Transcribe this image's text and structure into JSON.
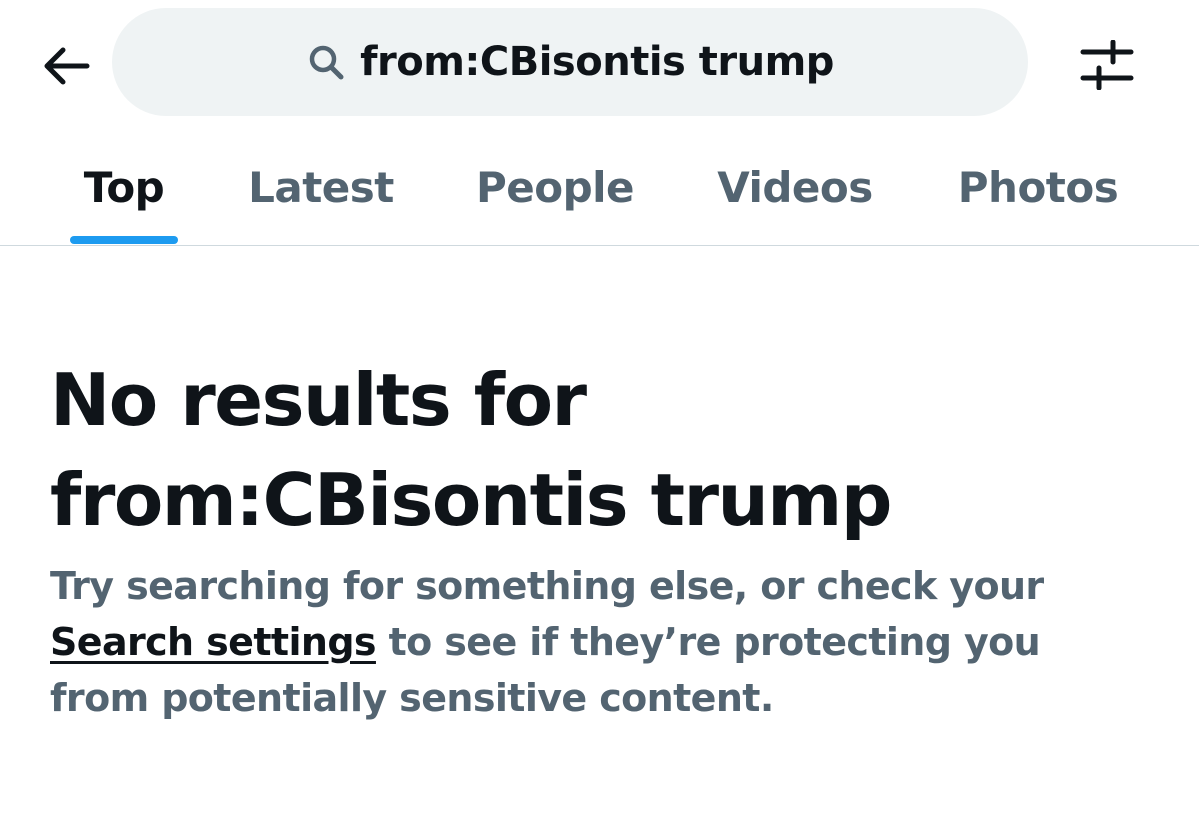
{
  "header": {
    "back_icon": "arrow-left-icon",
    "search": {
      "icon": "search-icon",
      "query": "from:CBisontis trump"
    },
    "filter_icon": "sliders-icon"
  },
  "tabs": [
    {
      "label": "Top",
      "active": true
    },
    {
      "label": "Latest",
      "active": false
    },
    {
      "label": "People",
      "active": false
    },
    {
      "label": "Videos",
      "active": false
    },
    {
      "label": "Photos",
      "active": false
    }
  ],
  "empty_state": {
    "title_line1": "No results for",
    "title_line2": "from:CBisontis trump",
    "desc_line1": "Try searching for something else, or check your",
    "settings_link": "Search settings",
    "desc_line2_rest": " to see if they’re protecting you",
    "desc_line3": "from potentially sensitive content."
  },
  "colors": {
    "text_primary": "#0f1419",
    "text_secondary": "#536471",
    "accent": "#1d9bf0",
    "search_bg": "#eff3f4",
    "divider": "#cfd9de"
  }
}
